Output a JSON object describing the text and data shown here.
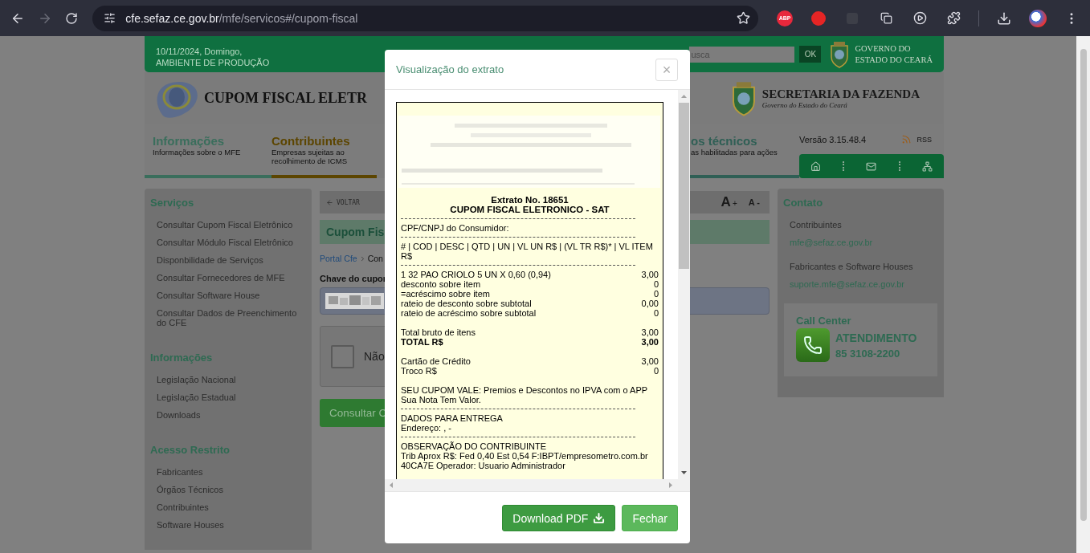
{
  "browser": {
    "url_host": "cfe.sefaz.ce.gov.br",
    "url_path": "/mfe/servicos#/cupom-fiscal",
    "forward_disabled": true,
    "extension_badge": "ABP"
  },
  "topbar": {
    "date": "10/11/2024, Domingo,",
    "environment": "AMBIENTE DE PRODUÇÃO",
    "search_placeholder": "usca",
    "search_button": "OK",
    "government": [
      "GOVERNO DO",
      "ESTADO DO CEARÁ"
    ]
  },
  "banner": {
    "site_title": "CUPOM FISCAL ELETR",
    "agency": "SECRETARIA DA FAZENDA",
    "agency_subtitle": "Governo do Estado do Ceará"
  },
  "nav": {
    "items": [
      {
        "title": "Informações",
        "subtitle": "Informações sobre o MFE",
        "color": "#3a6e5c"
      },
      {
        "title": "Contribuintes",
        "subtitle": "Empresas sujeitas ao recolhimento de ICMS",
        "color": "#5c4500"
      },
      {
        "title": "os técnicos",
        "subtitle": "as habilitadas para ações",
        "color": "#2f5f55"
      }
    ],
    "version": "Versão 3.15.48.4",
    "rss": "RSS"
  },
  "sidebar": {
    "sections": [
      {
        "title": "Serviços",
        "items": [
          "Consultar Cupom Fiscal Eletrônico",
          "Consultar Módulo Fiscal Eletrônico",
          "Disponbilidade de Serviços",
          "Consultar Fornecedores de MFE",
          "Consultar Software House",
          "Consultar Dados de Preenchimento do CFE"
        ]
      },
      {
        "title": "Informações",
        "items": [
          "Legislação Nacional",
          "Legislação Estadual",
          "Downloads"
        ]
      },
      {
        "title": "Acesso Restrito",
        "items": [
          "Fabricantes",
          "Órgãos Técnicos",
          "Contribuintes",
          "Software Houses"
        ]
      }
    ]
  },
  "content": {
    "back": "VOLTAR",
    "font_increase": "A+",
    "font_decrease": "A -",
    "title": "Cupom Fis",
    "breadcrumb": {
      "link": "Portal Cfe",
      "current": "Con"
    },
    "key_label": "Chave do cupor",
    "captcha": {
      "checked": false,
      "label": "Não"
    },
    "submit": "Consultar C"
  },
  "contact": {
    "title": "Contato",
    "items": [
      {
        "kind": "label",
        "text": "Contribuintes"
      },
      {
        "kind": "email",
        "text": "mfe@sefaz.ce.gov.br"
      },
      {
        "kind": "label",
        "text": "Fabricantes e Software Houses"
      },
      {
        "kind": "email",
        "text": "suporte.mfe@sefaz.ce.gov.br"
      }
    ]
  },
  "call_center": {
    "title": "Call Center",
    "heading": "ATENDIMENTO",
    "phone": "85 3108-2200"
  },
  "modal": {
    "title": "Visualização do extrato",
    "close": "×",
    "receipt": [
      {
        "kind": "redacted"
      },
      {
        "kind": "title",
        "text": "Extrato No. 18651"
      },
      {
        "kind": "title",
        "text": "CUPOM FISCAL ELETRONICO - SAT"
      },
      {
        "kind": "separator"
      },
      {
        "kind": "text",
        "text": "CPF/CNPJ do Consumidor:"
      },
      {
        "kind": "separator"
      },
      {
        "kind": "text",
        "text": "# | COD | DESC | QTD | UN | VL UN R$ | (VL TR R$)* | VL ITEM R$"
      },
      {
        "kind": "separator"
      },
      {
        "kind": "pair",
        "label": "1 32 PAO CRIOLO 5 UN X 0,60 (0,94)",
        "value": "3,00",
        "bold": false
      },
      {
        "kind": "pair",
        "label": "desconto sobre item",
        "value": "0",
        "bold": false
      },
      {
        "kind": "pair",
        "label": "=acréscimo sobre item",
        "value": "0",
        "bold": false
      },
      {
        "kind": "pair",
        "label": "rateio de desconto sobre subtotal",
        "value": "0,00",
        "bold": false
      },
      {
        "kind": "pair",
        "label": "rateio de acréscimo sobre subtotal",
        "value": "0",
        "bold": false
      },
      {
        "kind": "gap"
      },
      {
        "kind": "pair",
        "label": "Total bruto de itens",
        "value": "3,00",
        "bold": false
      },
      {
        "kind": "pair",
        "label": "TOTAL R$",
        "value": "3,00",
        "bold": true
      },
      {
        "kind": "gap"
      },
      {
        "kind": "pair",
        "label": "Cartão de Crédito",
        "value": "3,00",
        "bold": false
      },
      {
        "kind": "pair",
        "label": "Troco R$",
        "value": "0",
        "bold": false
      },
      {
        "kind": "gap"
      },
      {
        "kind": "text",
        "text": "SEU CUPOM VALE: Premios e Descontos no IPVA com o APP Sua Nota Tem Valor."
      },
      {
        "kind": "separator"
      },
      {
        "kind": "text",
        "text": "DADOS PARA ENTREGA"
      },
      {
        "kind": "text",
        "text": "Endereço: , -"
      },
      {
        "kind": "separator"
      },
      {
        "kind": "text",
        "text": "OBSERVAÇÃO DO CONTRIBUINTE"
      },
      {
        "kind": "text",
        "text": "Trib Aprox R$: Fed 0,40 Est 0,54 F:IBPT/empresometro.com.br"
      },
      {
        "kind": "text",
        "text": "40CA7E Operador: Usuario Administrador"
      }
    ],
    "buttons": [
      {
        "label": "Download PDF",
        "kind": "primary"
      },
      {
        "label": "Fechar",
        "kind": "secondary"
      }
    ]
  }
}
